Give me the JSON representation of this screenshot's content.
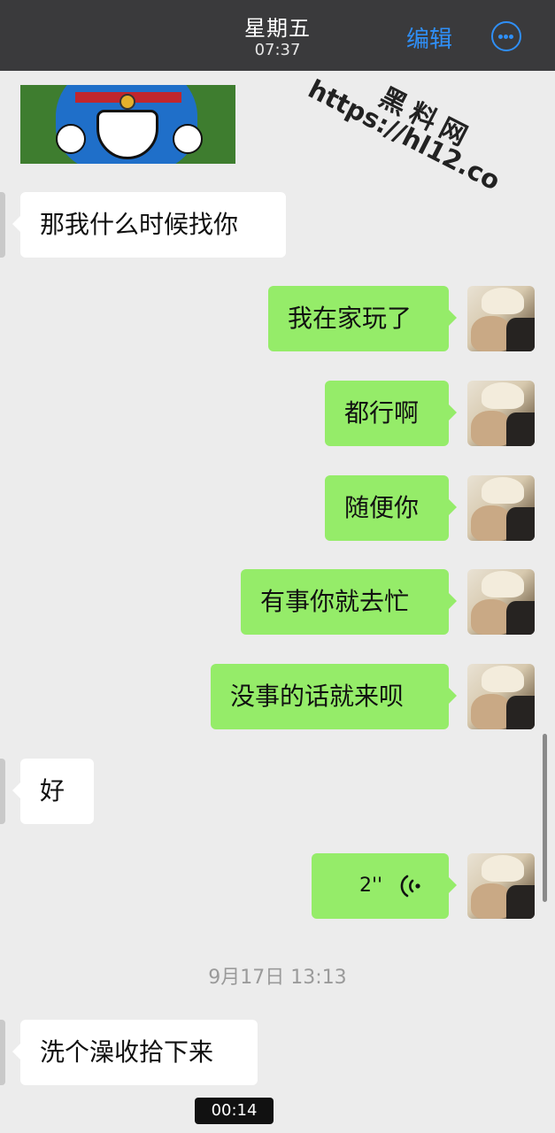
{
  "header": {
    "title": "星期五",
    "time": "07:37",
    "edit_label": "编辑",
    "more_icon": "more-icon",
    "accent_color": "#2f8ff7",
    "background_color": "#3a3a3c"
  },
  "watermark": {
    "top_text": "黑料网",
    "bottom_text": "https://hl12.co"
  },
  "messages": [
    {
      "side": "in",
      "text": "那我什么时候找你"
    },
    {
      "side": "out",
      "text": "我在家玩了"
    },
    {
      "side": "out",
      "text": "都行啊"
    },
    {
      "side": "out",
      "text": "随便你"
    },
    {
      "side": "out",
      "text": "有事你就去忙"
    },
    {
      "side": "out",
      "text": "没事的话就来呗"
    },
    {
      "side": "in",
      "text": "好"
    },
    {
      "side": "out",
      "type": "voice",
      "duration": "2''"
    },
    {
      "side": "in",
      "text": "洗个澡收拾下来"
    }
  ],
  "date_separator": "9月17日 13:13",
  "video_timer": "00:14",
  "colors": {
    "outgoing_bubble": "#95ec69",
    "incoming_bubble": "#ffffff",
    "chat_background": "#ececec"
  }
}
